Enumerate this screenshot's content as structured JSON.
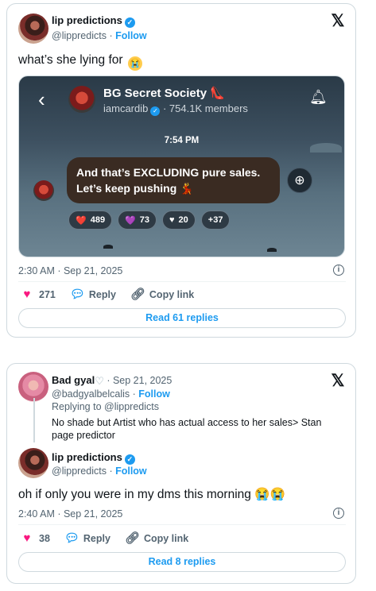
{
  "tweet1": {
    "author_name": "lip predictions",
    "handle": "@lippredicts",
    "follow_label": "Follow",
    "text": "what’s she lying for",
    "emoji": "😭",
    "media": {
      "group_name": "BG Secret Society",
      "group_emoji": "👠",
      "owner": "iamcardib",
      "members": "754.1K members",
      "time": "7:54 PM",
      "message_line1": "And that’s EXCLUDING pure sales.",
      "message_line2": "Let’s keep pushing",
      "message_emoji": "💃",
      "reactions": [
        {
          "icon": "❤️",
          "count": "489"
        },
        {
          "icon": "💜",
          "count": "73"
        },
        {
          "icon": "♥",
          "count": "20"
        },
        {
          "icon": "",
          "count": "+37"
        }
      ]
    },
    "timestamp": "2:30 AM · Sep 21, 2025",
    "likes": "271",
    "reply_label": "Reply",
    "copy_label": "Copy link",
    "read_replies": "Read 61 replies"
  },
  "tweet2": {
    "parent_name": "Bad gyal",
    "parent_date": "Sep 21, 2025",
    "parent_handle": "@badgyalbelcalis",
    "follow_label": "Follow",
    "replying_to": "Replying to @lippredicts",
    "parent_text": "No shade but Artist who has actual access to her sales> Stan page predictor",
    "author_name": "lip predictions",
    "handle": "@lippredicts",
    "text": "oh if only you were in my dms this morning",
    "emojis": "😭😭",
    "timestamp": "2:40 AM · Sep 21, 2025",
    "likes": "38",
    "reply_label": "Reply",
    "copy_label": "Copy link",
    "read_replies": "Read 8 replies"
  },
  "icons": {
    "x_logo": "x-logo-icon",
    "verified": "verified-badge-icon",
    "heart": "heart-icon",
    "reply": "reply-bubble-icon",
    "link": "link-icon",
    "info": "info-icon"
  },
  "colors": {
    "accent": "#1d9bf0",
    "like": "#f91880",
    "muted": "#536471",
    "border": "#cfd9de"
  }
}
